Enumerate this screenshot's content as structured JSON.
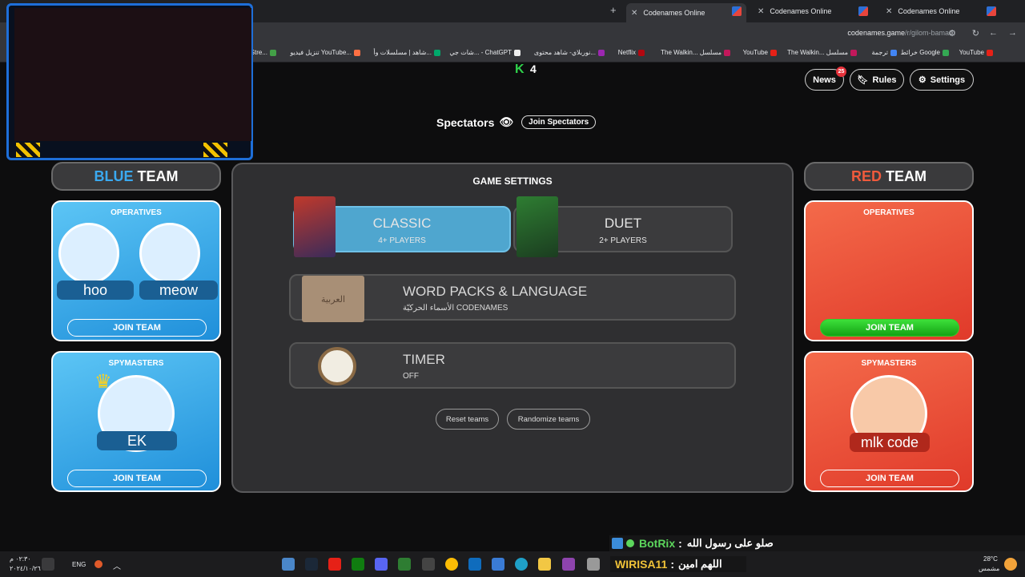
{
  "browser": {
    "tabs": [
      {
        "title": "Codenames Online",
        "active": true
      },
      {
        "title": "Codenames Online",
        "active": false
      },
      {
        "title": "Codenames Online",
        "active": false
      }
    ],
    "url_host": "codenames.game",
    "url_path": "/r/gilom-bamad",
    "bookmarks": [
      "YouTube",
      "خرائط Google",
      "ترجمة",
      "The Walkin... مسلسل",
      "YouTube",
      "The Walkin... مسلسل",
      "Netflix",
      "نوربلاي- شاهد محتوى...",
      "شات جي... - ChatGPT",
      "شاهد | مسلسلات وأ...",
      "تنزيل فيديو YouTube...",
      "Stre..."
    ]
  },
  "header": {
    "k_count": "4",
    "news_label": "News",
    "news_badge": "25",
    "rules_label": "Rules",
    "settings_label": "Settings"
  },
  "spectators": {
    "label": "Spectators",
    "join_label": "Join Spectators"
  },
  "blue_team": {
    "title_color_word": "BLUE",
    "title_word": "TEAM",
    "operatives_label": "OPERATIVES",
    "operatives": [
      "hoo",
      "meow"
    ],
    "operatives_join": "JOIN TEAM",
    "spymasters_label": "SPYMASTERS",
    "spymasters": [
      "EK"
    ],
    "spymasters_join": "JOIN TEAM",
    "color": "#2b9be8"
  },
  "red_team": {
    "title_color_word": "RED",
    "title_word": "TEAM",
    "operatives_label": "OPERATIVES",
    "operatives_join": "JOIN TEAM",
    "spymasters_label": "SPYMASTERS",
    "spymasters": [
      "mlk code"
    ],
    "spymasters_join": "JOIN TEAM",
    "color": "#f05a3c"
  },
  "game_settings": {
    "title": "GAME SETTINGS",
    "modes": [
      {
        "name": "CLASSIC",
        "players": "4+ PLAYERS",
        "selected": true
      },
      {
        "name": "DUET",
        "players": "2+ PLAYERS",
        "selected": false
      }
    ],
    "word_packs": {
      "title": "WORD PACKS & LANGUAGE",
      "value": "الأسماء الحركيّة CODENAMES",
      "box_label": "العربية"
    },
    "timer": {
      "title": "TIMER",
      "value": "OFF"
    },
    "reset_label": "Reset teams",
    "randomize_label": "Randomize teams"
  },
  "chat": [
    {
      "user": "BotRix",
      "message": "صلو على رسول الله"
    },
    {
      "user": "WIRISA11",
      "message": "اللهم امين"
    }
  ],
  "taskbar": {
    "time": "٠٢:٣٠ م",
    "date": "٢٠٢٤/١٠/٢٦",
    "lang": "ENG",
    "temp": "28°C",
    "weather": "مشمس"
  }
}
